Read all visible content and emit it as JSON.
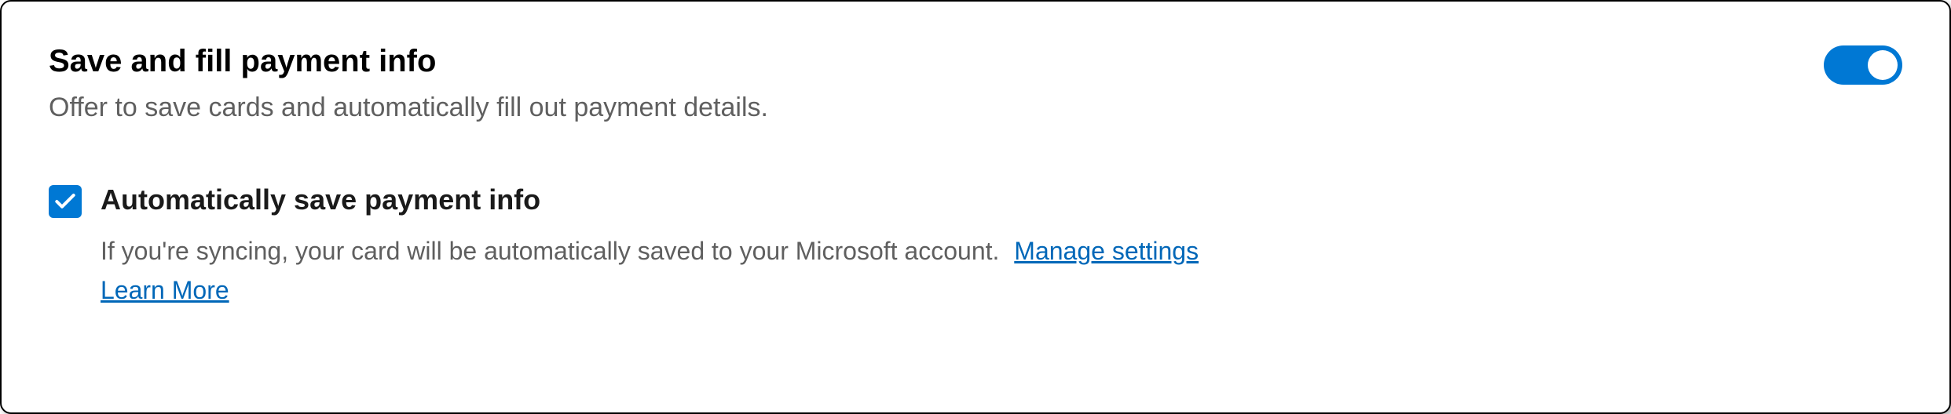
{
  "header": {
    "title": "Save and fill payment info",
    "subtitle": "Offer to save cards and automatically fill out payment details.",
    "toggle_on": true
  },
  "auto_save": {
    "checked": true,
    "title": "Automatically save payment info",
    "description": "If you're syncing, your card will be automatically saved to your Microsoft account.",
    "manage_link": "Manage settings",
    "learn_more_link": "Learn More"
  },
  "colors": {
    "accent": "#0078d4",
    "link": "#0067b8"
  }
}
